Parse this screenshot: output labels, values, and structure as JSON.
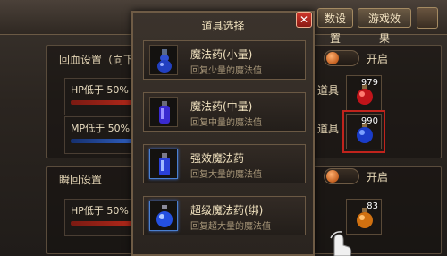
{
  "tabs": {
    "tab_a": "数设置",
    "tab_b": "游戏效果"
  },
  "group_hp": {
    "title": "回血设置（向下",
    "hp_label": "HP低于 50%",
    "mp_label": "MP低于 50%",
    "toggle_label": "开启",
    "item_caption_1": "道具",
    "item_caption_2": "道具",
    "slot1_count": "979",
    "slot2_count": "990"
  },
  "group_instant": {
    "title": "瞬回设置",
    "hp_label": "HP低于 50%",
    "toggle_label": "开启",
    "slot3_count": "83"
  },
  "dialog": {
    "title": "道具选择",
    "close_glyph": "✕",
    "items": [
      {
        "name": "魔法药(小量)",
        "desc": "回复少量的魔法值",
        "icon": "small-blue-potion-icon"
      },
      {
        "name": "魔法药(中量)",
        "desc": "回复中量的魔法值",
        "icon": "medium-blue-potion-icon"
      },
      {
        "name": "强效魔法药",
        "desc": "回复大量的魔法值",
        "icon": "strong-blue-potion-icon"
      },
      {
        "name": "超级魔法药(绑)",
        "desc": "回复超大量的魔法值",
        "icon": "super-blue-potion-icon"
      }
    ]
  },
  "colors": {
    "accent_gold": "#a48a62",
    "selected_outline": "#c0231c",
    "hp_bar": "#b0281a",
    "mp_bar": "#2f5fc0"
  }
}
